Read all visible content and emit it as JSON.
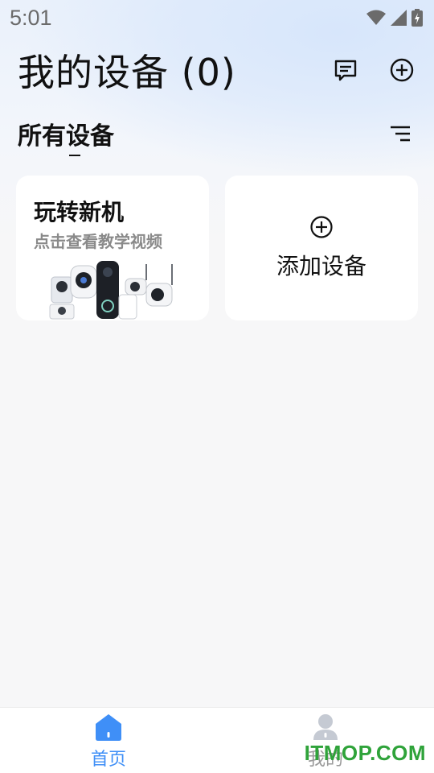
{
  "status_bar": {
    "time": "5:01"
  },
  "header": {
    "title": "我的设备 (0)",
    "message_icon": "message-icon",
    "add_icon": "add-circle-icon"
  },
  "section": {
    "title": "所有设备",
    "sort_icon": "sort-lines-icon"
  },
  "cards": {
    "tutorial": {
      "title": "玩转新机",
      "subtitle": "点击查看教学视频"
    },
    "add": {
      "label": "添加设备"
    }
  },
  "tabbar": {
    "items": [
      {
        "label": "首页",
        "icon": "home-icon",
        "active": true
      },
      {
        "label": "我的",
        "icon": "user-icon",
        "active": false
      }
    ]
  },
  "watermark": "ITMOP.COM",
  "colors": {
    "accent": "#3f8ff7",
    "watermark": "#2fa33a"
  }
}
